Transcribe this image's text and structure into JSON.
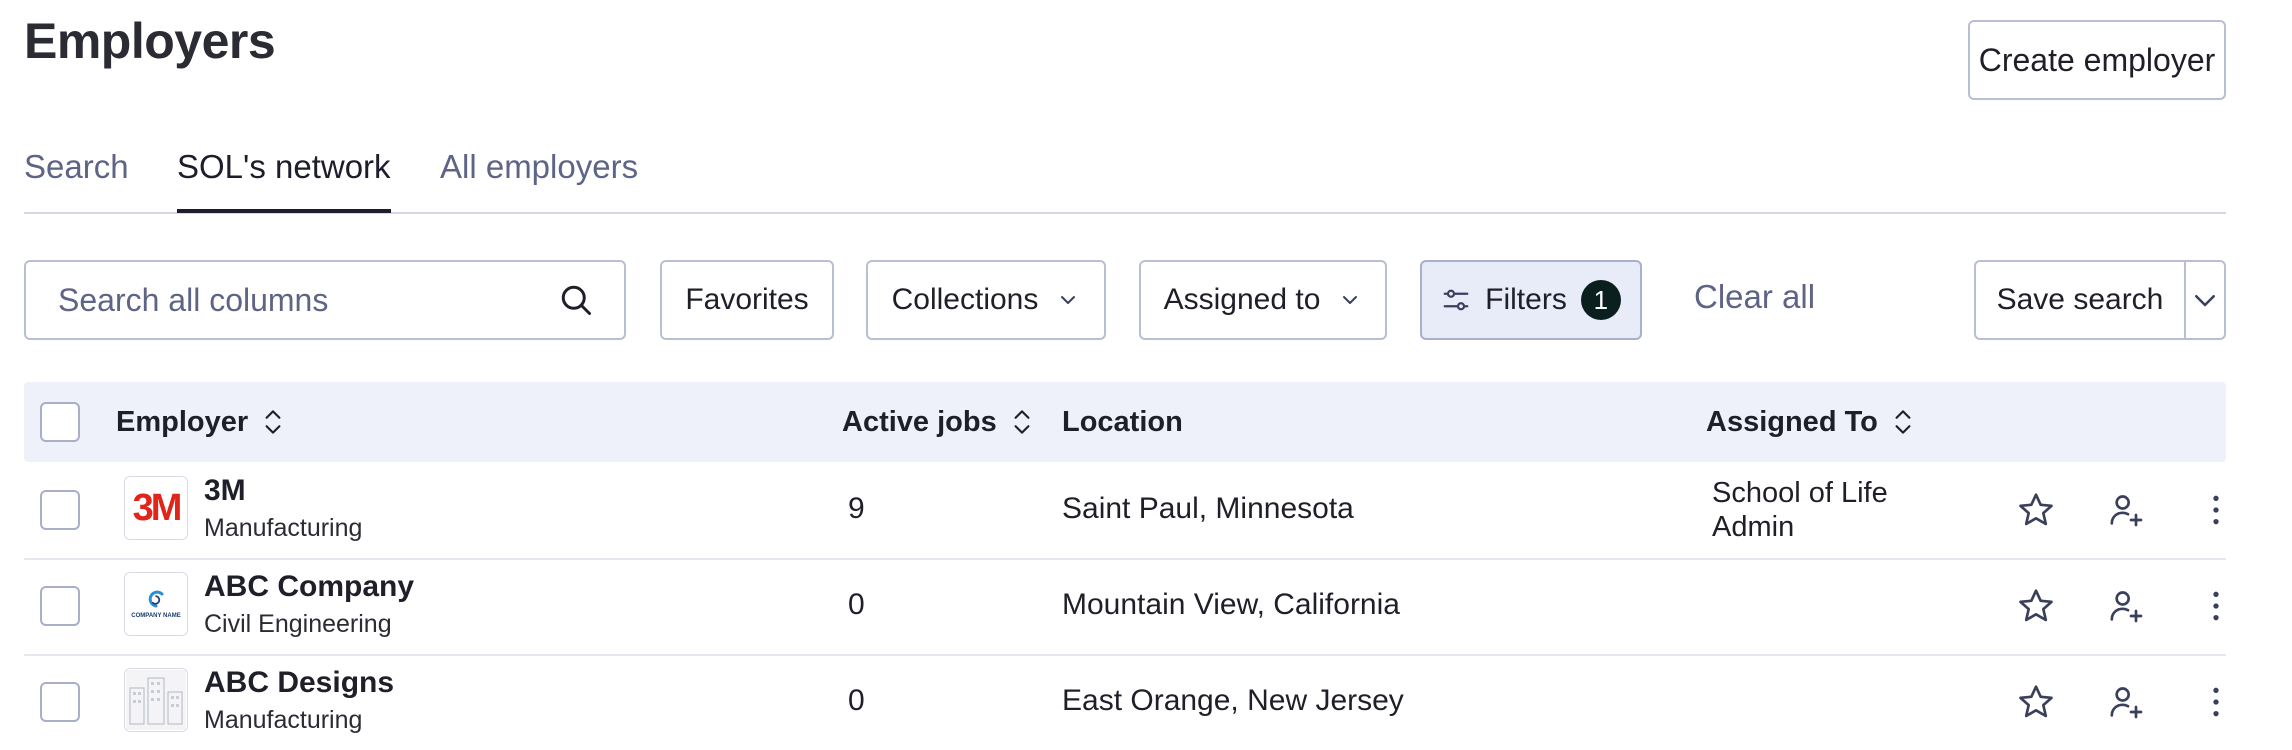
{
  "page": {
    "title": "Employers"
  },
  "header": {
    "create_label": "Create employer"
  },
  "tabs": [
    {
      "label": "Search"
    },
    {
      "label": "SOL's network"
    },
    {
      "label": "All employers"
    }
  ],
  "toolbar": {
    "search_placeholder": "Search all columns",
    "favorites_label": "Favorites",
    "collections_label": "Collections",
    "assigned_to_label": "Assigned to",
    "filters_label": "Filters",
    "filters_count": "1",
    "clear_all_label": "Clear all",
    "save_search_label": "Save search"
  },
  "table": {
    "columns": {
      "employer": "Employer",
      "active_jobs": "Active jobs",
      "location": "Location",
      "assigned_to": "Assigned To"
    },
    "rows": [
      {
        "name": "3M",
        "industry": "Manufacturing",
        "active_jobs": "9",
        "location": "Saint Paul, Minnesota",
        "assigned_line1": "School of Life",
        "assigned_line2": "Admin",
        "logo_text": "3M"
      },
      {
        "name": "ABC Company",
        "industry": "Civil Engineering",
        "active_jobs": "0",
        "location": "Mountain View, California",
        "assigned_line1": "",
        "assigned_line2": "",
        "logo_text": "COMPANY NAME"
      },
      {
        "name": "ABC Designs",
        "industry": "Manufacturing",
        "active_jobs": "0",
        "location": "East Orange, New Jersey",
        "assigned_line1": "",
        "assigned_line2": "",
        "logo_text": ""
      }
    ]
  },
  "icons": {
    "search": "search-icon",
    "chevron": "chevron-down-icon",
    "sliders": "sliders-icon",
    "sort": "sort-icon",
    "star": "star-icon",
    "assign": "user-plus-icon",
    "more": "more-vertical-icon"
  },
  "colors": {
    "accent": "#1d1d2b",
    "muted_text": "#5e6485",
    "border": "#b9bfd3",
    "header_bg": "#eef1f9",
    "filters_bg": "#e8ebf8",
    "badge_bg": "#0c1f1f",
    "logo_3m": "#e1251b"
  }
}
